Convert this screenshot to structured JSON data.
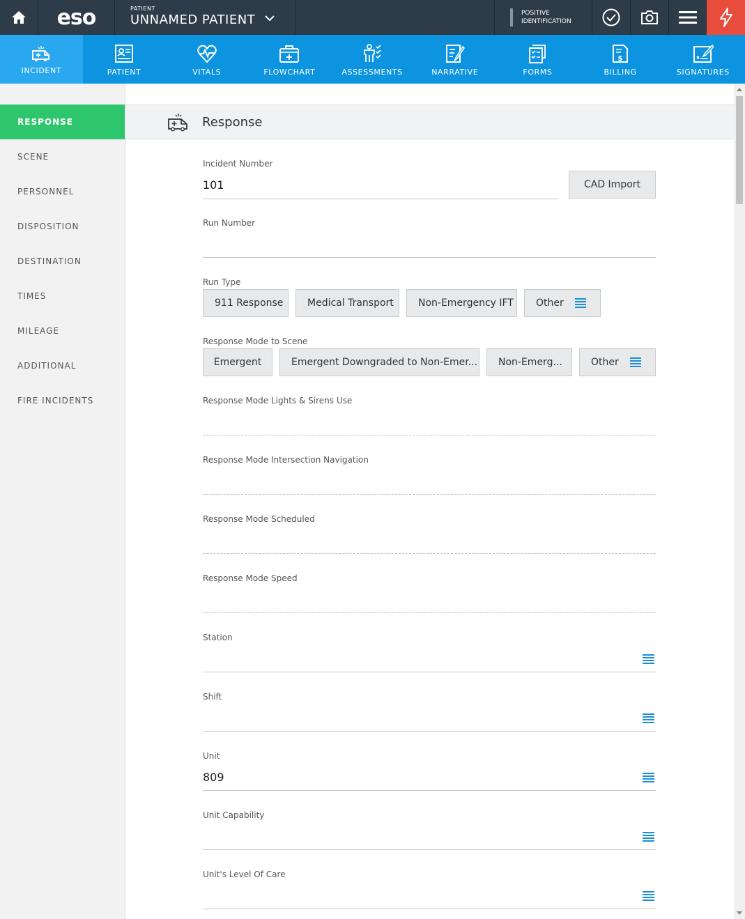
{
  "topbar": {
    "logo": "eso",
    "patient_label": "PATIENT",
    "patient_name": "UNNAMED PATIENT",
    "positive_id_line1": "POSITIVE",
    "positive_id_line2": "IDENTIFICATION",
    "icons": [
      "home-icon",
      "chevron-down-icon",
      "checkmark-icon",
      "camera-icon",
      "hamburger-menu-icon",
      "flash-icon"
    ]
  },
  "nav": {
    "items": [
      {
        "label": "INCIDENT",
        "icon": "ambulance-icon",
        "active": true
      },
      {
        "label": "PATIENT",
        "icon": "patient-card-icon"
      },
      {
        "label": "VITALS",
        "icon": "heart-pulse-icon"
      },
      {
        "label": "FLOWCHART",
        "icon": "medkit-icon"
      },
      {
        "label": "ASSESSMENTS",
        "icon": "person-check-icon"
      },
      {
        "label": "NARRATIVE",
        "icon": "pencil-doc-icon"
      },
      {
        "label": "FORMS",
        "icon": "checklist-icon"
      },
      {
        "label": "BILLING",
        "icon": "billing-doc-icon"
      },
      {
        "label": "SIGNATURES",
        "icon": "signature-icon"
      }
    ]
  },
  "sidebar": {
    "items": [
      {
        "label": "RESPONSE",
        "active": true
      },
      {
        "label": "SCENE"
      },
      {
        "label": "PERSONNEL"
      },
      {
        "label": "DISPOSITION"
      },
      {
        "label": "DESTINATION"
      },
      {
        "label": "TIMES"
      },
      {
        "label": "MILEAGE"
      },
      {
        "label": "ADDITIONAL"
      },
      {
        "label": "FIRE INCIDENTS"
      }
    ]
  },
  "section": {
    "title": "Response"
  },
  "form": {
    "incident_number": {
      "label": "Incident Number",
      "value": "101"
    },
    "cad_import": "CAD Import",
    "run_number": {
      "label": "Run Number",
      "value": ""
    },
    "run_type": {
      "label": "Run Type",
      "options": [
        "911 Response",
        "Medical Transport",
        "Non-Emergency IFT",
        "Other"
      ]
    },
    "response_mode": {
      "label": "Response Mode to Scene",
      "options": [
        "Emergent",
        "Emergent Downgraded to Non-Emer...",
        "Non-Emerg...",
        "Other"
      ]
    },
    "lights_sirens": {
      "label": "Response Mode Lights & Sirens Use"
    },
    "intersection": {
      "label": "Response Mode Intersection Navigation"
    },
    "scheduled": {
      "label": "Response Mode Scheduled"
    },
    "speed": {
      "label": "Response Mode Speed"
    },
    "station": {
      "label": "Station",
      "value": ""
    },
    "shift": {
      "label": "Shift",
      "value": ""
    },
    "unit": {
      "label": "Unit",
      "value": "809"
    },
    "unit_capability": {
      "label": "Unit Capability",
      "value": ""
    },
    "unit_level_of_care": {
      "label": "Unit's Level Of Care",
      "value": ""
    }
  },
  "colors": {
    "topbar": "#2e3b48",
    "nav": "#0d94e0",
    "nav_active": "#29a8f0",
    "sidebar_active": "#2dc66d",
    "flash": "#e84c3d",
    "list_icon": "#1a8fd6"
  }
}
